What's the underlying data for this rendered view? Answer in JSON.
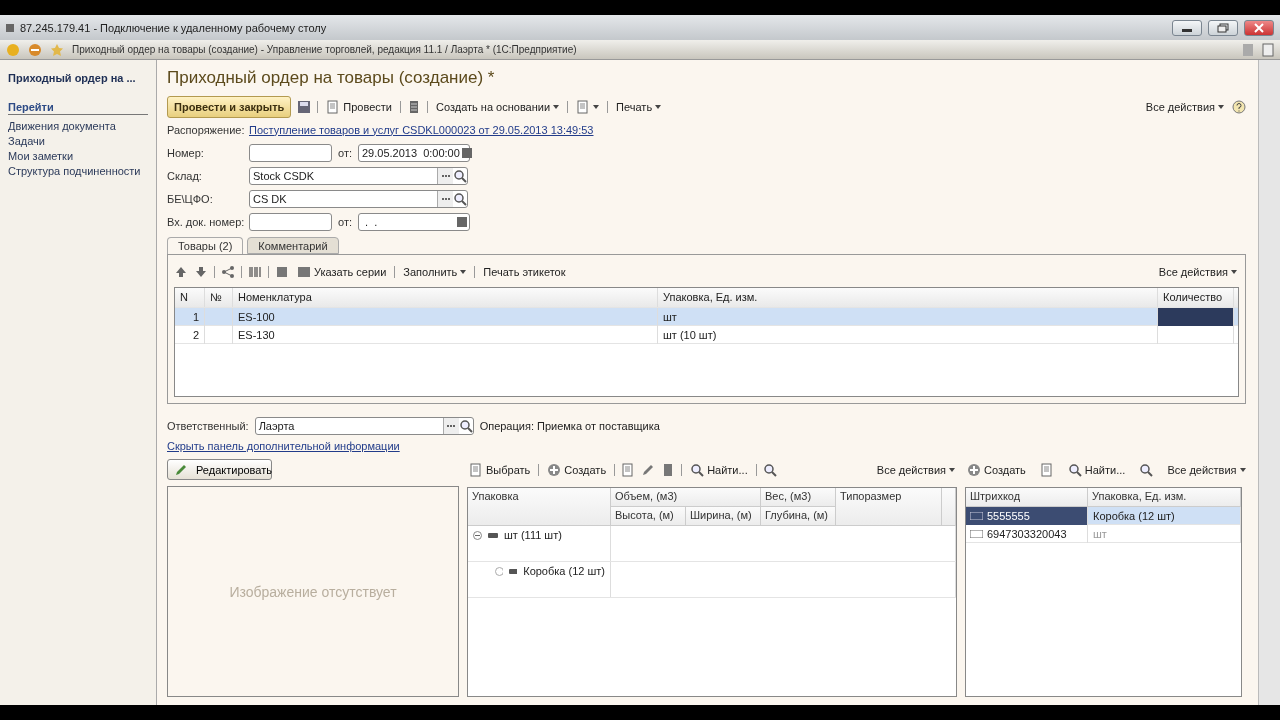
{
  "remote_window": {
    "title": "87.245.179.41 - Подключение к удаленному рабочему столу"
  },
  "app_window": {
    "title": "Приходный ордер на товары (создание) - Управление торговлей, редакция 11.1 / Лаэрта * (1С:Предприятие)"
  },
  "sidebar": {
    "title": "Приходный ордер на ...",
    "section": "Перейти",
    "items": [
      "Движения документа",
      "Задачи",
      "Мои заметки",
      "Структура подчиненности"
    ]
  },
  "form": {
    "title": "Приходный ордер на товары (создание) *",
    "toolbar": {
      "primary": "Провести и закрыть",
      "post": "Провести",
      "create_based": "Создать на основании",
      "print": "Печать",
      "all_actions": "Все действия"
    },
    "fields": [
      {
        "kind": "link",
        "label": "Распоряжение:",
        "value": "Поступление товаров и услуг CSDKL000023 от 29.05.2013 13:49:53"
      },
      {
        "kind": "number_date",
        "label": "Номер:",
        "date_label": "от:",
        "date": "29.05.2013  0:00:00"
      },
      {
        "kind": "select",
        "label": "Склад:",
        "value": "Stock CSDK"
      },
      {
        "kind": "select",
        "label": "БЕ\\ЦФО:",
        "value": "CS DK"
      },
      {
        "kind": "number_date",
        "label": "Вх. док. номер:",
        "date_label": "от:",
        "date": " .  ."
      }
    ],
    "tabs": [
      {
        "label": "Товары (2)",
        "selected": true
      },
      {
        "label": "Комментарий",
        "selected": false
      }
    ],
    "goods": {
      "toolbar": [
        "Указать серии",
        "Заполнить",
        "Печать этикеток"
      ],
      "all_actions": "Все действия",
      "columns": [
        "N",
        "№",
        "Номенклатура",
        "Упаковка, Ед. изм.",
        "Количество"
      ],
      "rows": [
        {
          "n": "1",
          "item": "ES-100",
          "unit": "шт",
          "selected": true
        },
        {
          "n": "2",
          "item": "ES-130",
          "unit": "шт (10 шт)",
          "selected": false
        }
      ]
    },
    "responsible": {
      "label": "Ответственный:",
      "value": "Лаэрта"
    },
    "operation": "Операция: Приемка от поставщика",
    "hide_link": "Скрыть панель дополнительной информации",
    "image_panel": {
      "edit_button": "Редактировать",
      "placeholder": "Изображение отсутствует"
    },
    "packages": {
      "toolbar": {
        "select": "Выбрать",
        "create": "Создать",
        "find": "Найти...",
        "all_actions": "Все действия"
      },
      "columns": {
        "name": "Упаковка",
        "volume": "Объем, (м3)",
        "weight": "Вес, (м3)",
        "size": "Типоразмер",
        "height": "Высота, (м)",
        "width": "Ширина, (м)",
        "depth": "Глубина, (м)"
      },
      "tree": [
        {
          "label": "шт (111 шт)",
          "expanded": true,
          "children": [
            {
              "label": "Коробка (12 шт)"
            }
          ]
        }
      ]
    },
    "barcodes": {
      "toolbar": {
        "create": "Создать",
        "find": "Найти...",
        "all_actions": "Все действия"
      },
      "columns": [
        "Штрихкод",
        "Упаковка, Ед. изм."
      ],
      "rows": [
        {
          "code": "5555555",
          "unit": "Коробка (12 шт)",
          "selected": true
        },
        {
          "code": "6947303320043",
          "unit": "шт",
          "selected": false
        }
      ]
    }
  }
}
